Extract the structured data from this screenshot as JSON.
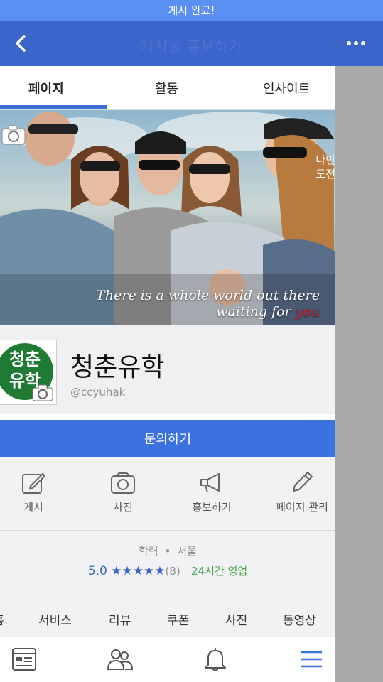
{
  "status_bar": {
    "message": "게시 완료!"
  },
  "nav": {
    "title": "게시물 홍보하기",
    "back_icon": "chevron-left-icon",
    "more_icon": "more-horizontal-icon"
  },
  "tabs": [
    {
      "label": "페이지",
      "active": true
    },
    {
      "label": "활동",
      "active": false
    },
    {
      "label": "인사이트",
      "active": false
    }
  ],
  "cover": {
    "quote_line1": "There is a whole world out there",
    "quote_line2_prefix": "waiting for ",
    "quote_line2_highlight": "you",
    "side_text_line1": "나만",
    "side_text_line2": "도전"
  },
  "profile": {
    "avatar_text_line1": "청춘",
    "avatar_text_line2": "유학",
    "name": "청춘유학",
    "handle": "@ccyuhak"
  },
  "cta_button": {
    "label": "문의하기"
  },
  "actions": [
    {
      "label": "게시",
      "icon": "edit-icon"
    },
    {
      "label": "사진",
      "icon": "camera-icon"
    },
    {
      "label": "홍보하기",
      "icon": "megaphone-icon"
    },
    {
      "label": "페이지 관리",
      "icon": "pencil-icon"
    }
  ],
  "info": {
    "category": "학력",
    "location": "서울",
    "rating": "5.0 ★★★★★",
    "review_count": "(8)",
    "hours": "24시간 영업"
  },
  "subnav": [
    {
      "label": "홈"
    },
    {
      "label": "서비스"
    },
    {
      "label": "리뷰"
    },
    {
      "label": "쿠폰"
    },
    {
      "label": "사진"
    },
    {
      "label": "동영상"
    }
  ],
  "bottom_bar": [
    "news-feed-icon",
    "friends-icon",
    "bell-icon",
    "menu-icon"
  ],
  "colors": {
    "status_bar": "#5b8ff2",
    "nav_bar": "#3b65c9",
    "accent": "#3b72e0",
    "open_green": "#43a047"
  }
}
